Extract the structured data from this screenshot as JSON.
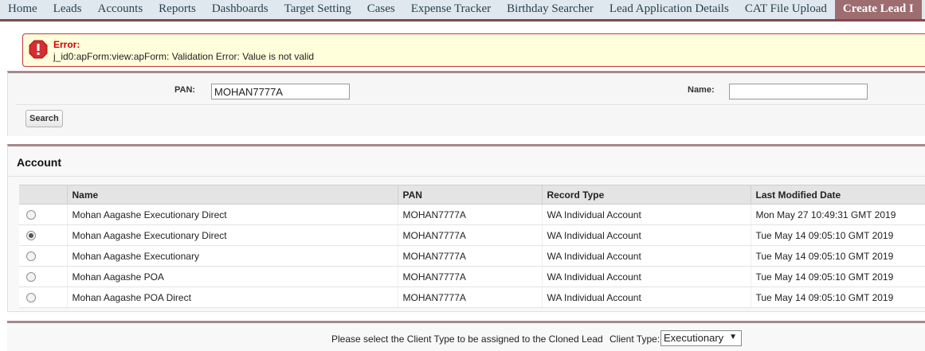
{
  "nav": {
    "tabs": [
      {
        "label": "Home"
      },
      {
        "label": "Leads"
      },
      {
        "label": "Accounts"
      },
      {
        "label": "Reports"
      },
      {
        "label": "Dashboards"
      },
      {
        "label": "Target Setting"
      },
      {
        "label": "Cases"
      },
      {
        "label": "Expense Tracker"
      },
      {
        "label": "Birthday Searcher"
      },
      {
        "label": "Lead Application Details"
      },
      {
        "label": "CAT File Upload"
      },
      {
        "label": "Create Lead I"
      }
    ],
    "active_tab": "Create Lead I"
  },
  "error": {
    "title": "Error:",
    "message": "j_id0:apForm:view:apForm: Validation Error: Value is not valid",
    "icon": "error-icon",
    "color": "#c5383c"
  },
  "search": {
    "pan_label": "PAN:",
    "pan_value": "MOHAN7777A",
    "name_label": "Name:",
    "name_value": "",
    "search_button": "Search"
  },
  "account": {
    "title": "Account",
    "columns": [
      "Name",
      "PAN",
      "Record Type",
      "Last Modified Date"
    ],
    "rows": [
      {
        "selected": false,
        "name": "Mohan Aagashe Executionary Direct",
        "pan": "MOHAN7777A",
        "record_type": "WA Individual Account",
        "last_modified": "Mon May 27 10:49:31 GMT 2019"
      },
      {
        "selected": true,
        "name": "Mohan Aagashe Executionary Direct",
        "pan": "MOHAN7777A",
        "record_type": "WA Individual Account",
        "last_modified": "Tue May 14 09:05:10 GMT 2019"
      },
      {
        "selected": false,
        "name": "Mohan Aagashe Executionary",
        "pan": "MOHAN7777A",
        "record_type": "WA Individual Account",
        "last_modified": "Tue May 14 09:05:10 GMT 2019"
      },
      {
        "selected": false,
        "name": "Mohan Aagashe POA",
        "pan": "MOHAN7777A",
        "record_type": "WA Individual Account",
        "last_modified": "Tue May 14 09:05:10 GMT 2019"
      },
      {
        "selected": false,
        "name": "Mohan Aagashe POA Direct",
        "pan": "MOHAN7777A",
        "record_type": "WA Individual Account",
        "last_modified": "Tue May 14 09:05:10 GMT 2019"
      }
    ]
  },
  "footer": {
    "prompt": "Please select the Client Type to be assigned to the Cloned Lead",
    "client_type_label": "Client Type:",
    "client_type_value": "Executionary"
  },
  "colors": {
    "nav_bg": "#dfe8ee",
    "accent": "#7f4a4e",
    "active_tab": "#9d6d70",
    "error_bg": "#ffffdc"
  }
}
